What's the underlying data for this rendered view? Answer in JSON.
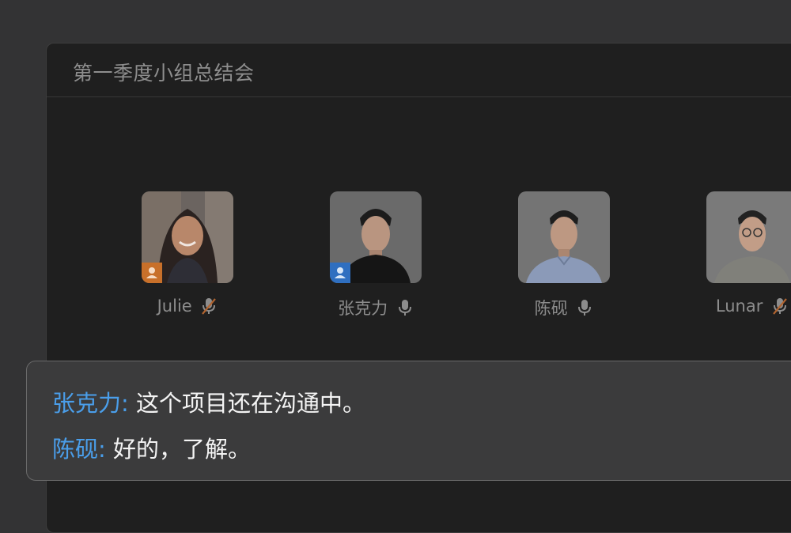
{
  "meeting": {
    "title": "第一季度小组总结会"
  },
  "participants": [
    {
      "name": "Julie",
      "mic": "muted",
      "badge": "host",
      "badge_color": "#c8702a"
    },
    {
      "name": "张克力",
      "mic": "on",
      "badge": "co-host",
      "badge_color": "#2f6fc0"
    },
    {
      "name": "陈砚",
      "mic": "on",
      "badge": null
    },
    {
      "name": "Lunar",
      "mic": "muted",
      "badge": null
    }
  ],
  "captions": [
    {
      "speaker": "张克力:",
      "text": "这个项目还在沟通中。"
    },
    {
      "speaker": "陈砚:",
      "text": "好的，了解。"
    }
  ],
  "colors": {
    "speaker_accent": "#4a9eea",
    "muted_slash": "#b2642f",
    "host_badge": "#c8702a",
    "cohost_badge": "#2f6fc0"
  }
}
